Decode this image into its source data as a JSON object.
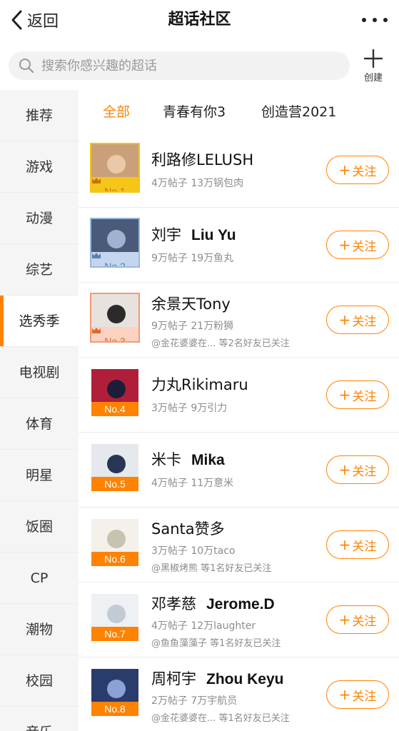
{
  "topbar": {
    "back_label": "返回",
    "title": "超话社区"
  },
  "search": {
    "placeholder": "搜索你感兴趣的超话",
    "create_label": "创建"
  },
  "sidebar": {
    "items": [
      {
        "label": "推荐"
      },
      {
        "label": "游戏"
      },
      {
        "label": "动漫"
      },
      {
        "label": "综艺"
      },
      {
        "label": "选秀季",
        "active": true
      },
      {
        "label": "电视剧"
      },
      {
        "label": "体育"
      },
      {
        "label": "明星"
      },
      {
        "label": "饭圈"
      },
      {
        "label": "CP"
      },
      {
        "label": "潮物"
      },
      {
        "label": "校园"
      },
      {
        "label": "音乐"
      }
    ]
  },
  "subtabs": [
    {
      "label": "全部",
      "active": true
    },
    {
      "label": "青春有你3"
    },
    {
      "label": "创造营2021"
    }
  ],
  "follow_label": "关注",
  "colors": {
    "accent": "#ff8200",
    "gold": "#f5c518",
    "silver": "#9ab8dd",
    "bronze": "#f29a74"
  },
  "list": [
    {
      "rank": "No.1",
      "name": "利路修LELUSH",
      "name_en": "",
      "stats": "4万帖子 13万锅包肉",
      "friends": "",
      "tier": "gold"
    },
    {
      "rank": "No.2",
      "name": "刘宇",
      "name_en": "Liu Yu",
      "stats": "9万帖子 19万鱼丸",
      "friends": "",
      "tier": "silver"
    },
    {
      "rank": "No.3",
      "name": "余景天Tony",
      "name_en": "",
      "stats": "9万帖子 21万粉狮",
      "friends": "@金花婆婆在... 等2名好友已关注",
      "tier": "bronze"
    },
    {
      "rank": "No.4",
      "name": "力丸Rikimaru",
      "name_en": "",
      "stats": "3万帖子 9万引力",
      "friends": "",
      "tier": "plain"
    },
    {
      "rank": "No.5",
      "name": "米卡",
      "name_en": "Mika",
      "stats": "4万帖子 11万意米",
      "friends": "",
      "tier": "plain"
    },
    {
      "rank": "No.6",
      "name": "Santa赞多",
      "name_en": "",
      "stats": "3万帖子 10万taco",
      "friends": "@黑椒烤熊 等1名好友已关注",
      "tier": "plain"
    },
    {
      "rank": "No.7",
      "name": "邓孝慈",
      "name_en": "Jerome.D",
      "stats": "4万帖子 12万laughter",
      "friends": "@鱼鱼藻藻子 等1名好友已关注",
      "tier": "plain"
    },
    {
      "rank": "No.8",
      "name": "周柯宇",
      "name_en": "Zhou Keyu",
      "stats": "2万帖子 7万宇航员",
      "friends": "@金花婆婆在... 等1名好友已关注",
      "tier": "plain"
    }
  ]
}
